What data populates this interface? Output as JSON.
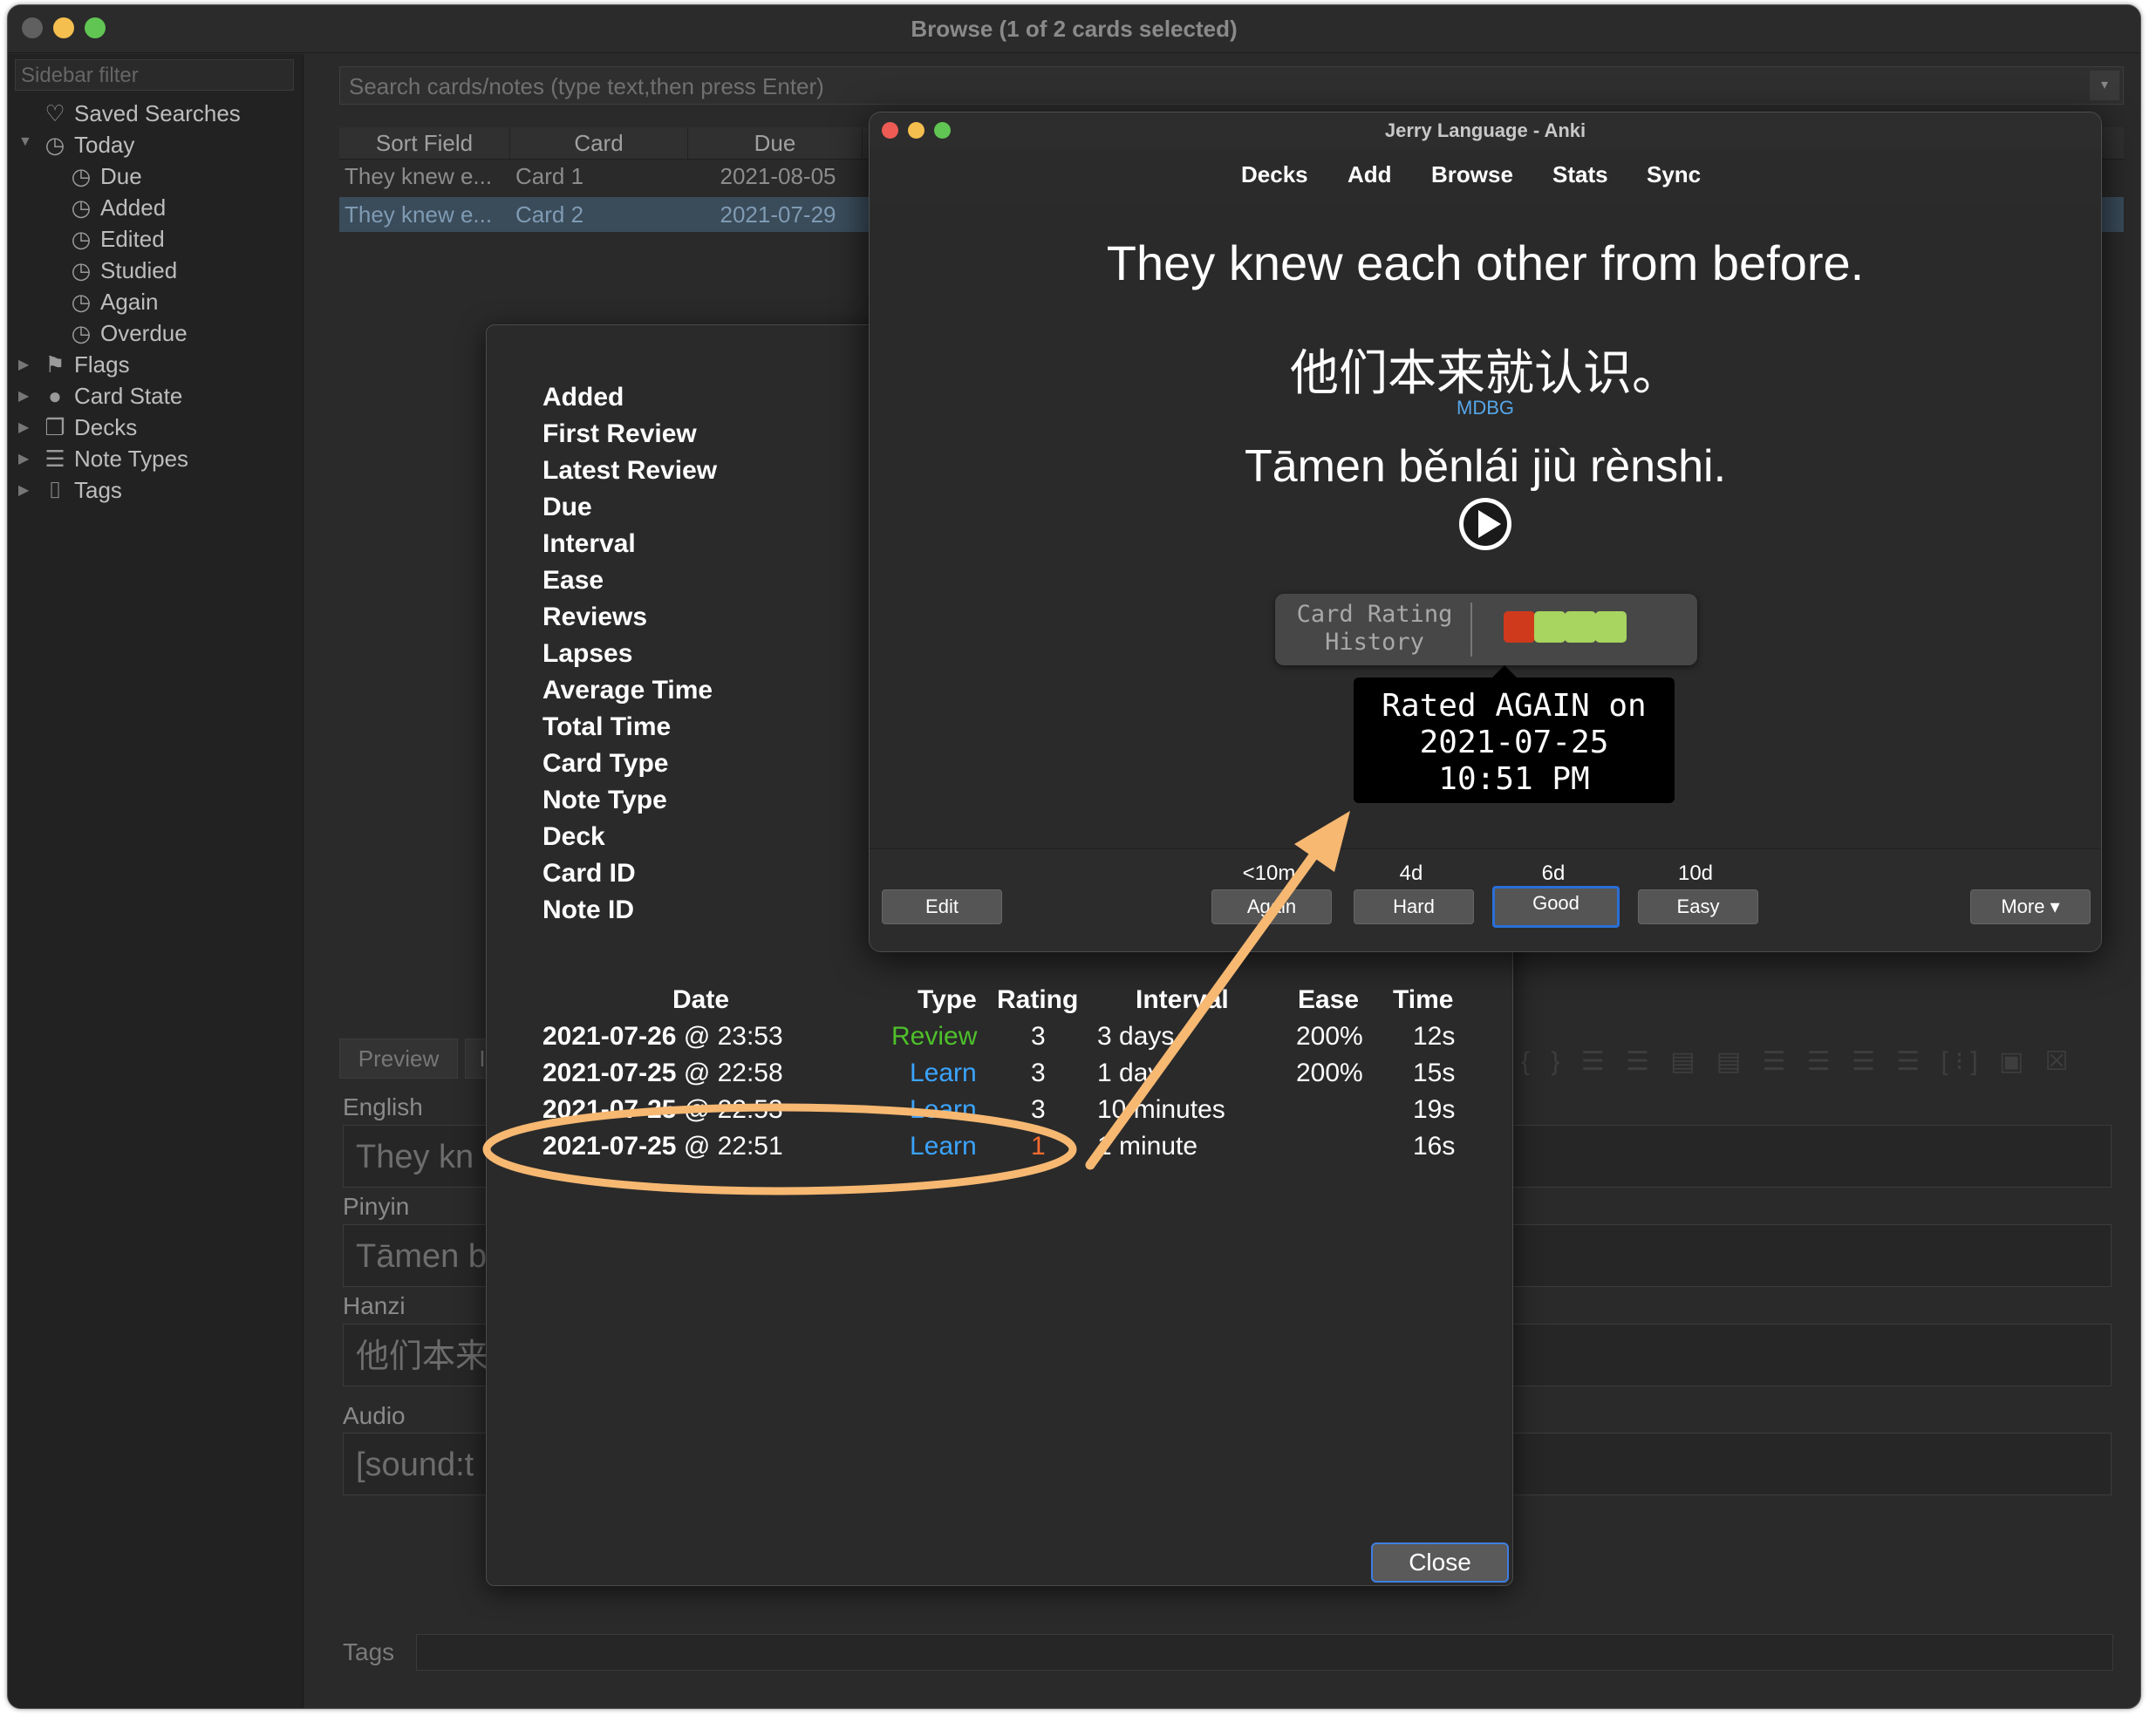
{
  "browse": {
    "title": "Browse (1 of 2 cards selected)",
    "sidebar": {
      "filter_placeholder": "Sidebar filter",
      "items": [
        {
          "label": "Saved Searches",
          "icon": "heart-icon"
        },
        {
          "label": "Today",
          "icon": "clock-icon"
        },
        {
          "label": "Due",
          "icon": "clock-icon"
        },
        {
          "label": "Added",
          "icon": "clock-icon"
        },
        {
          "label": "Edited",
          "icon": "clock-icon"
        },
        {
          "label": "Studied",
          "icon": "clock-icon"
        },
        {
          "label": "Again",
          "icon": "clock-icon"
        },
        {
          "label": "Overdue",
          "icon": "clock-icon"
        },
        {
          "label": "Flags",
          "icon": "flag-icon"
        },
        {
          "label": "Card State",
          "icon": "circle-icon"
        },
        {
          "label": "Decks",
          "icon": "cards-icon"
        },
        {
          "label": "Note Types",
          "icon": "list-icon"
        },
        {
          "label": "Tags",
          "icon": "tag-icon"
        }
      ]
    },
    "search_placeholder": "Search cards/notes (type text,then press Enter)",
    "table": {
      "columns": [
        "Sort Field",
        "Card",
        "Due"
      ],
      "rows": [
        {
          "sort_field": "They knew e...",
          "card": "Card 1",
          "due": "2021-08-05"
        },
        {
          "sort_field": "They knew e...",
          "card": "Card 2",
          "due": "2021-07-29"
        }
      ]
    },
    "editor": {
      "tabs": [
        "Preview",
        "I"
      ],
      "fields": [
        {
          "label": "English",
          "value": "They kn"
        },
        {
          "label": "Pinyin",
          "value": "Tāmen b"
        },
        {
          "label": "Hanzi",
          "value": "他们本来"
        },
        {
          "label": "Audio",
          "value": "[sound:t"
        }
      ],
      "tags_label": "Tags"
    }
  },
  "card_info": {
    "keys": [
      "Added",
      "First Review",
      "Latest Review",
      "Due",
      "Interval",
      "Ease",
      "Reviews",
      "Lapses",
      "Average Time",
      "Total Time",
      "Card Type",
      "Note Type",
      "Deck",
      "Card ID",
      "Note ID"
    ],
    "review_headers": {
      "date": "Date",
      "type": "Type",
      "rating": "Rating",
      "interval": "Interval",
      "ease": "Ease",
      "time": "Time"
    },
    "reviews": [
      {
        "date": "2021-07-26",
        "time_of_day": "@ 23:53",
        "type": "Review",
        "rating": "3",
        "interval": "3 days",
        "ease": "200%",
        "time": "12s"
      },
      {
        "date": "2021-07-25",
        "time_of_day": "@ 22:58",
        "type": "Learn",
        "rating": "3",
        "interval": "1 day",
        "ease": "200%",
        "time": "15s"
      },
      {
        "date": "2021-07-25",
        "time_of_day": "@ 22:53",
        "type": "Learn",
        "rating": "3",
        "interval": "10 minutes",
        "ease": "",
        "time": "19s"
      },
      {
        "date": "2021-07-25",
        "time_of_day": "@ 22:51",
        "type": "Learn",
        "rating": "1",
        "interval": "1 minute",
        "ease": "",
        "time": "16s"
      }
    ],
    "close_label": "Close"
  },
  "anki": {
    "title": "Jerry Language - Anki",
    "nav": [
      "Decks",
      "Add",
      "Browse",
      "Stats",
      "Sync"
    ],
    "card": {
      "english": "They knew each other from before.",
      "hanzi": "他们本来就认识。",
      "mdbg_link": "MDBG",
      "pinyin": "Tāmen běnlái jiù rènshi."
    },
    "rating_history": {
      "label": "Card Rating History",
      "squares": [
        "#d03a1c",
        "#a8d460",
        "#a8d460",
        "#a8d460"
      ],
      "tooltip_line1": "Rated AGAIN on",
      "tooltip_line2": "2021-07-25",
      "tooltip_line3": "10:51 PM"
    },
    "answer": {
      "edit_label": "Edit",
      "more_label": "More ▾",
      "buttons": [
        {
          "interval": "<10m",
          "label": "Again"
        },
        {
          "interval": "4d",
          "label": "Hard"
        },
        {
          "interval": "6d",
          "label": "Good"
        },
        {
          "interval": "10d",
          "label": "Easy"
        }
      ]
    }
  },
  "colors": {
    "annotation": "#f7b872",
    "review_type": "#4ec12a",
    "learn_type": "#3ba4ff",
    "again_rating": "#ff6b2e"
  }
}
